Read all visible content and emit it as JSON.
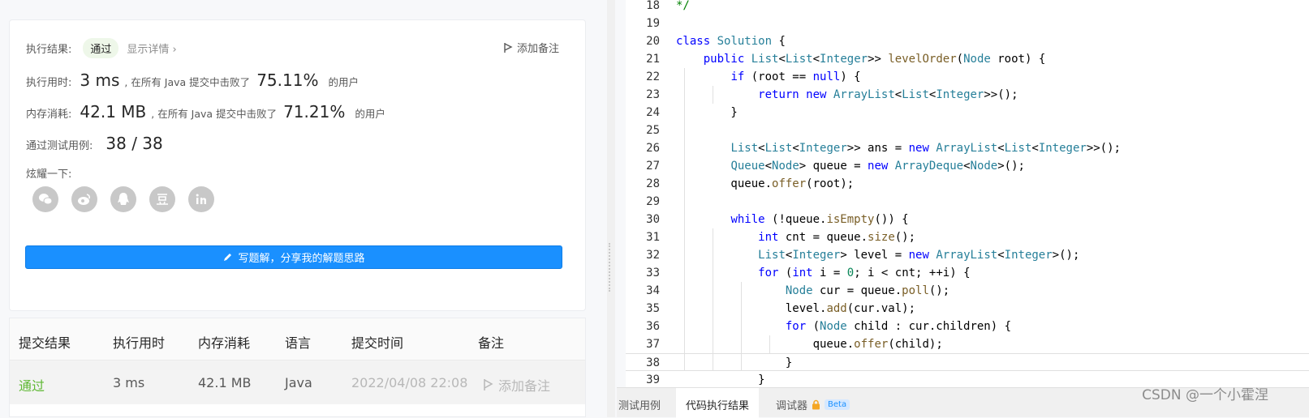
{
  "summary": {
    "result_label": "执行结果:",
    "result_value": "通过",
    "show_detail": "显示详情 ›",
    "add_note": "添加备注",
    "runtime_label": "执行用时:",
    "runtime_value": "3 ms",
    "runtime_text": ", 在所有 Java 提交中击败了",
    "runtime_pct": "75.11%",
    "runtime_suffix": "的用户",
    "memory_label": "内存消耗:",
    "memory_value": "42.1 MB",
    "memory_text": ", 在所有 Java 提交中击败了",
    "memory_pct": "71.21%",
    "memory_suffix": "的用户",
    "tests_label": "通过测试用例:",
    "tests_value": "38 / 38",
    "share_label": "炫耀一下:",
    "share_icons": [
      "wechat-icon",
      "weibo-icon",
      "qq-icon",
      "douban-icon",
      "linkedin-icon"
    ],
    "write_solution": "写题解，分享我的解题思路"
  },
  "table": {
    "headers": [
      "提交结果",
      "执行用时",
      "内存消耗",
      "语言",
      "提交时间",
      "备注"
    ],
    "row": {
      "result": "通过",
      "runtime": "3 ms",
      "memory": "42.1 MB",
      "language": "Java",
      "time": "2022/04/08 22:08",
      "note": "添加备注"
    }
  },
  "editor": {
    "lines": [
      {
        "n": "18",
        "t": "*/"
      },
      {
        "n": "19",
        "t": ""
      },
      {
        "n": "20",
        "t": "class Solution {"
      },
      {
        "n": "21",
        "t": "    public List<List<Integer>> levelOrder(Node root) {"
      },
      {
        "n": "22",
        "t": "        if (root == null) {"
      },
      {
        "n": "23",
        "t": "            return new ArrayList<List<Integer>>();"
      },
      {
        "n": "24",
        "t": "        }"
      },
      {
        "n": "25",
        "t": ""
      },
      {
        "n": "26",
        "t": "        List<List<Integer>> ans = new ArrayList<List<Integer>>();"
      },
      {
        "n": "27",
        "t": "        Queue<Node> queue = new ArrayDeque<Node>();"
      },
      {
        "n": "28",
        "t": "        queue.offer(root);"
      },
      {
        "n": "29",
        "t": ""
      },
      {
        "n": "30",
        "t": "        while (!queue.isEmpty()) {"
      },
      {
        "n": "31",
        "t": "            int cnt = queue.size();"
      },
      {
        "n": "32",
        "t": "            List<Integer> level = new ArrayList<Integer>();"
      },
      {
        "n": "33",
        "t": "            for (int i = 0; i < cnt; ++i) {"
      },
      {
        "n": "34",
        "t": "                Node cur = queue.poll();"
      },
      {
        "n": "35",
        "t": "                level.add(cur.val);"
      },
      {
        "n": "36",
        "t": "                for (Node child : cur.children) {"
      },
      {
        "n": "37",
        "t": "                    queue.offer(child);"
      },
      {
        "n": "38",
        "t": "                }"
      },
      {
        "n": "39",
        "t": "            }"
      }
    ]
  },
  "bottom_tabs": {
    "test_cases": "测试用例",
    "run_result": "代码执行结果",
    "debugger": "调试器",
    "beta": "Beta"
  },
  "watermark": "CSDN @一个小霍涅"
}
